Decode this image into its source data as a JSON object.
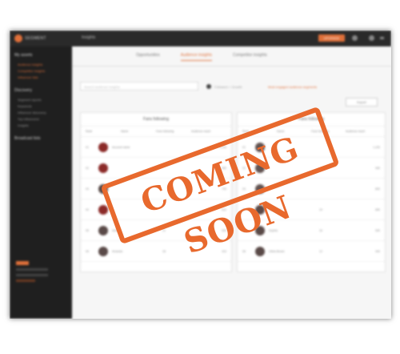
{
  "topbar": {
    "logo_text": "SEGMENT",
    "breadcrumb": "Insights",
    "cta_label": "UPGRADE"
  },
  "sidebar": {
    "section1_title": "My assets",
    "section1_items": [
      "Audience insights",
      "Competitor insights",
      "Influencer lists"
    ],
    "section2_title": "Discovery",
    "section2_items": [
      "Segment reports",
      "Keywords",
      "Influencer discovery",
      "Top influencers",
      "Insights"
    ],
    "section3_title": "Broadcast lists"
  },
  "tabs": [
    {
      "label": "Opportunities",
      "active": false
    },
    {
      "label": "Audience insights",
      "active": true
    },
    {
      "label": "Competitor insights",
      "active": false
    }
  ],
  "search": {
    "placeholder": "Search audience insights"
  },
  "filters": {
    "radio_label": "Followers  ○  Growth",
    "link": "Most engaged audience segments"
  },
  "right_button": "Export",
  "panel_left": {
    "title": "Fans following",
    "columns": [
      "Rank",
      "Name",
      "Fans following",
      "Audience reach"
    ],
    "rows": [
      {
        "rank": "01",
        "name": "Account name",
        "v1": "",
        "v2": "1,234"
      },
      {
        "rank": "02",
        "name": "",
        "v1": "",
        "v2": "980"
      },
      {
        "rank": "03",
        "name": "",
        "v1": "",
        "v2": "740"
      },
      {
        "rank": "04",
        "name": "",
        "v1": "",
        "v2": "612"
      },
      {
        "rank": "05",
        "name": "Ashley",
        "v1": "21",
        "v2": "520"
      },
      {
        "rank": "06",
        "name": "Amanda",
        "v1": "18",
        "v2": "410"
      }
    ]
  },
  "panel_right": {
    "title": "Fans following",
    "columns": [
      "Rank",
      "Name",
      "Fans following",
      "Audience reach"
    ],
    "rows": [
      {
        "rank": "01",
        "name": "",
        "v1": "",
        "v2": "1,100"
      },
      {
        "rank": "02",
        "name": "",
        "v1": "",
        "v2": "930"
      },
      {
        "rank": "03",
        "name": "",
        "v1": "",
        "v2": "800"
      },
      {
        "rank": "04",
        "name": "Ella Jones",
        "v1": "19",
        "v2": "650"
      },
      {
        "rank": "05",
        "name": "Sophia",
        "v1": "16",
        "v2": "530"
      },
      {
        "rank": "06",
        "name": "Olivia Brown",
        "v1": "12",
        "v2": "440"
      }
    ]
  },
  "stamp_text": "COMING SOON",
  "colors": {
    "accent": "#e8692d",
    "sidebar": "#1f1f1f"
  }
}
